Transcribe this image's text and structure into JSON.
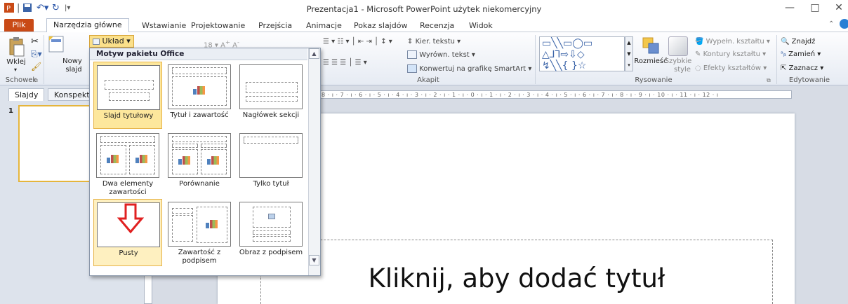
{
  "window": {
    "title": "Prezentacja1 - Microsoft PowerPoint użytek niekomercyjny",
    "controls": [
      "—",
      "□",
      "✕"
    ]
  },
  "tabs": {
    "file": "Plik",
    "items": [
      "Narzędzia główne",
      "Wstawianie",
      "Projektowanie",
      "Przejścia",
      "Animacje",
      "Pokaz slajdów",
      "Recenzja",
      "Widok"
    ],
    "active": "Narzędzia główne"
  },
  "ribbon": {
    "paste": "Wklej",
    "new_slide": [
      "Nowy",
      "slajd"
    ],
    "layout_button": "Układ",
    "font_size": "18",
    "text_direction": "Kier. tekstu",
    "align_text": "Wyrówn. tekst",
    "smartart": "Konwertuj na grafikę SmartArt",
    "arrange": "Rozmieść",
    "quick_styles": [
      "Szybkie",
      "style"
    ],
    "shape_fill": "Wypełn. kształtu",
    "shape_outline": "Kontury kształtu",
    "shape_effects": "Efekty kształtów",
    "find": "Znajdź",
    "replace": "Zamień",
    "select": "Zaznacz",
    "groups": {
      "clipboard": "Schowek",
      "paragraph": "Akapit",
      "drawing": "Rysowanie",
      "editing": "Edytowanie"
    }
  },
  "left_panel": {
    "tabs": [
      "Slajdy",
      "Konspekt"
    ],
    "thumb_number": "1"
  },
  "ruler": "8 · ı · 7 · ı · 6 · ı · 5 · ı · 4 · ı · 3 · ı · 2 · ı · 1 · ı · 0 · ı · 1 · ı · 2 · ı · 3 · ı · 4 · ı · 5 · ı · 6 · ı · 7 · ı · 8 · ı · 9 · ı · 10 · ı · 11 · ı · 12 · ı",
  "layout_gallery": {
    "header": "Motyw pakietu Office",
    "layouts": [
      {
        "label": "Slajd tytułowy",
        "selected": true
      },
      {
        "label": "Tytuł i zawartość"
      },
      {
        "label": "Nagłówek sekcji"
      },
      {
        "label": "Dwa elementy zawartości"
      },
      {
        "label": "Porównanie"
      },
      {
        "label": "Tylko tytuł"
      },
      {
        "label": "Pusty",
        "hovered": true
      },
      {
        "label": "Zawartość z podpisem"
      },
      {
        "label": "Obraz z podpisem"
      }
    ]
  },
  "slide": {
    "title_placeholder": "Kliknij, aby dodać tytuł"
  },
  "colors": {
    "file_tab": "#c94a16",
    "selection": "#fde79c",
    "arrow": "#e02020"
  }
}
